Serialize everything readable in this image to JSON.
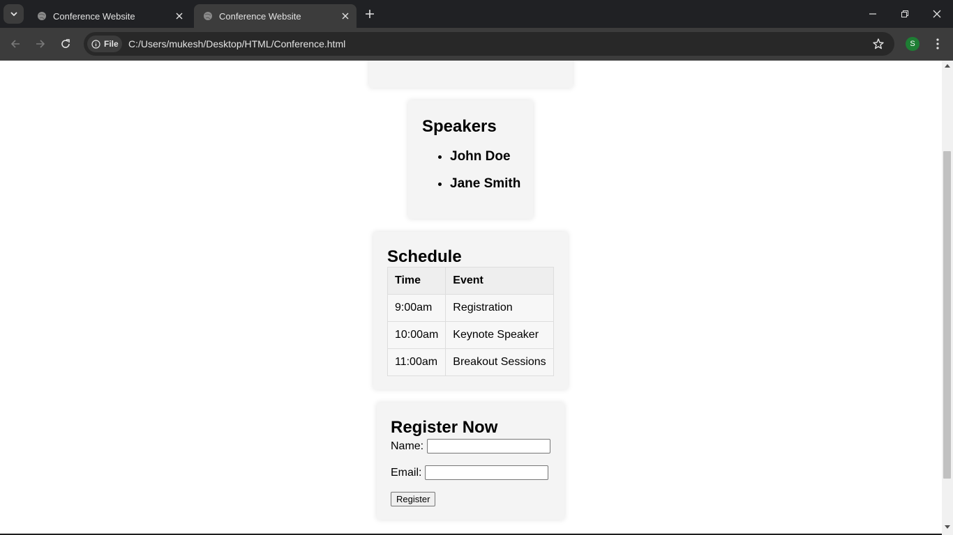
{
  "browser": {
    "tabs": [
      {
        "title": "Conference Website",
        "active": false
      },
      {
        "title": "Conference Website",
        "active": true
      }
    ],
    "url_chip": "File",
    "url": "C:/Users/mukesh/Desktop/HTML/Conference.html",
    "profile_initial": "S"
  },
  "speakers": {
    "heading": "Speakers",
    "items": [
      "John Doe",
      "Jane Smith"
    ]
  },
  "schedule": {
    "heading": "Schedule",
    "columns": [
      "Time",
      "Event"
    ],
    "rows": [
      [
        "9:00am",
        "Registration"
      ],
      [
        "10:00am",
        "Keynote Speaker"
      ],
      [
        "11:00am",
        "Breakout Sessions"
      ]
    ]
  },
  "register": {
    "heading": "Register Now",
    "name_label": "Name:",
    "email_label": "Email:",
    "name_value": "",
    "email_value": "",
    "button_label": "Register"
  }
}
